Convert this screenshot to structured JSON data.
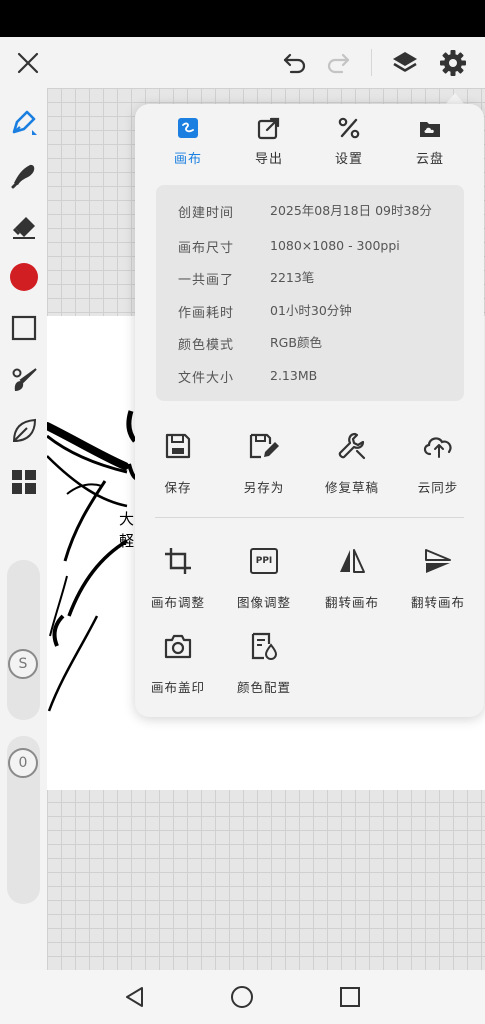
{
  "colors": {
    "accent": "#1a7fe0",
    "brush_color": "#d01e23",
    "icon_dark": "#333333",
    "icon_disabled": "#c4c4c4"
  },
  "top_bar": {
    "icons": [
      "close-icon",
      "undo-icon",
      "redo-icon",
      "layers-icon",
      "settings-icon"
    ]
  },
  "left_toolbar": {
    "tools": [
      "pen-icon",
      "smudge-icon",
      "eraser-icon",
      "color-swatch",
      "selection-icon",
      "brush-settings-icon",
      "leaf-icon",
      "gallery-icon"
    ],
    "size_slider_label": "S",
    "opacity_slider_label": "0"
  },
  "popup": {
    "tabs": [
      {
        "label": "画布",
        "icon": "canvas-icon"
      },
      {
        "label": "导出",
        "icon": "export-icon"
      },
      {
        "label": "设置",
        "icon": "settings-percent-icon"
      },
      {
        "label": "云盘",
        "icon": "cloud-drive-icon"
      }
    ],
    "info": [
      {
        "key": "创建时间",
        "value": "2025年08月18日 09时38分"
      },
      {
        "key": "画布尺寸",
        "value": "1080×1080 - 300ppi"
      },
      {
        "key": "一共画了",
        "value": "2213笔"
      },
      {
        "key": "作画耗时",
        "value": "01小时30分钟"
      },
      {
        "key": "颜色模式",
        "value": "RGB颜色"
      },
      {
        "key": "文件大小",
        "value": "2.13MB"
      }
    ],
    "actions_row1": [
      {
        "label": "保存",
        "icon": "save-icon"
      },
      {
        "label": "另存为",
        "icon": "save-as-icon"
      },
      {
        "label": "修复草稿",
        "icon": "repair-icon"
      },
      {
        "label": "云同步",
        "icon": "cloud-sync-icon"
      }
    ],
    "actions_row2": [
      {
        "label": "画布调整",
        "icon": "crop-icon"
      },
      {
        "label": "图像调整",
        "icon": "ppi-icon",
        "icon_text": "PPI"
      },
      {
        "label": "翻转画布",
        "icon": "flip-horizontal-icon"
      },
      {
        "label": "翻转画布",
        "icon": "flip-vertical-icon"
      }
    ],
    "actions_row3": [
      {
        "label": "画布盖印",
        "icon": "camera-icon"
      },
      {
        "label": "颜色配置",
        "icon": "color-config-icon"
      }
    ]
  },
  "nav_bar": {
    "icons": [
      "back-icon",
      "home-icon",
      "recents-icon"
    ]
  }
}
